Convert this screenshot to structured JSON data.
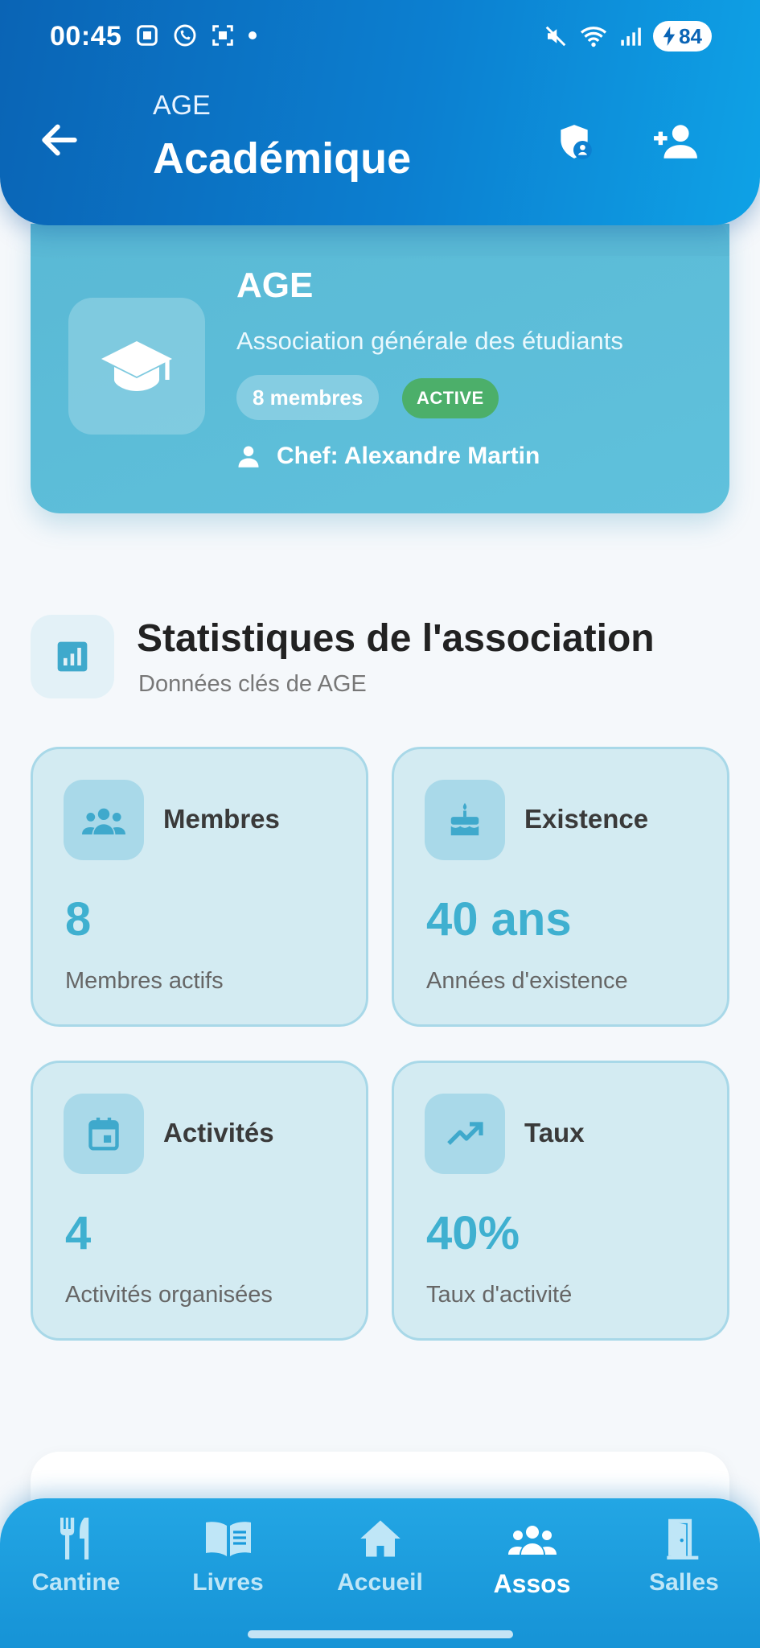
{
  "status_bar": {
    "time": "00:45",
    "battery": "84"
  },
  "header": {
    "subtitle": "AGE",
    "title": "Académique"
  },
  "association": {
    "name": "AGE",
    "description": "Association générale des étudiants",
    "members_badge": "8 membres",
    "status_badge": "ACTIVE",
    "chef": "Chef: Alexandre Martin"
  },
  "stats": {
    "title": "Statistiques de l'association",
    "subtitle": "Données clés de AGE",
    "cards": [
      {
        "label": "Membres",
        "value": "8",
        "desc": "Membres actifs",
        "icon": "group-icon"
      },
      {
        "label": "Existence",
        "value": "40 ans",
        "desc": "Années d'existence",
        "icon": "cake-icon"
      },
      {
        "label": "Activités",
        "value": "4",
        "desc": "Activités organisées",
        "icon": "calendar-icon"
      },
      {
        "label": "Taux",
        "value": "40%",
        "desc": "Taux d'activité",
        "icon": "trending-up-icon"
      }
    ]
  },
  "nav": {
    "items": [
      {
        "label": "Cantine",
        "icon": "fork-knife-icon"
      },
      {
        "label": "Livres",
        "icon": "book-icon"
      },
      {
        "label": "Accueil",
        "icon": "home-icon"
      },
      {
        "label": "Assos",
        "icon": "groups-icon",
        "active": true
      },
      {
        "label": "Salles",
        "icon": "door-icon"
      }
    ]
  },
  "colors": {
    "header_start": "#0a64b5",
    "header_end": "#0ea2e6",
    "card_accent": "#5ab9d5",
    "active_badge": "#4caf6a",
    "stat_value": "#3fb0d0"
  }
}
